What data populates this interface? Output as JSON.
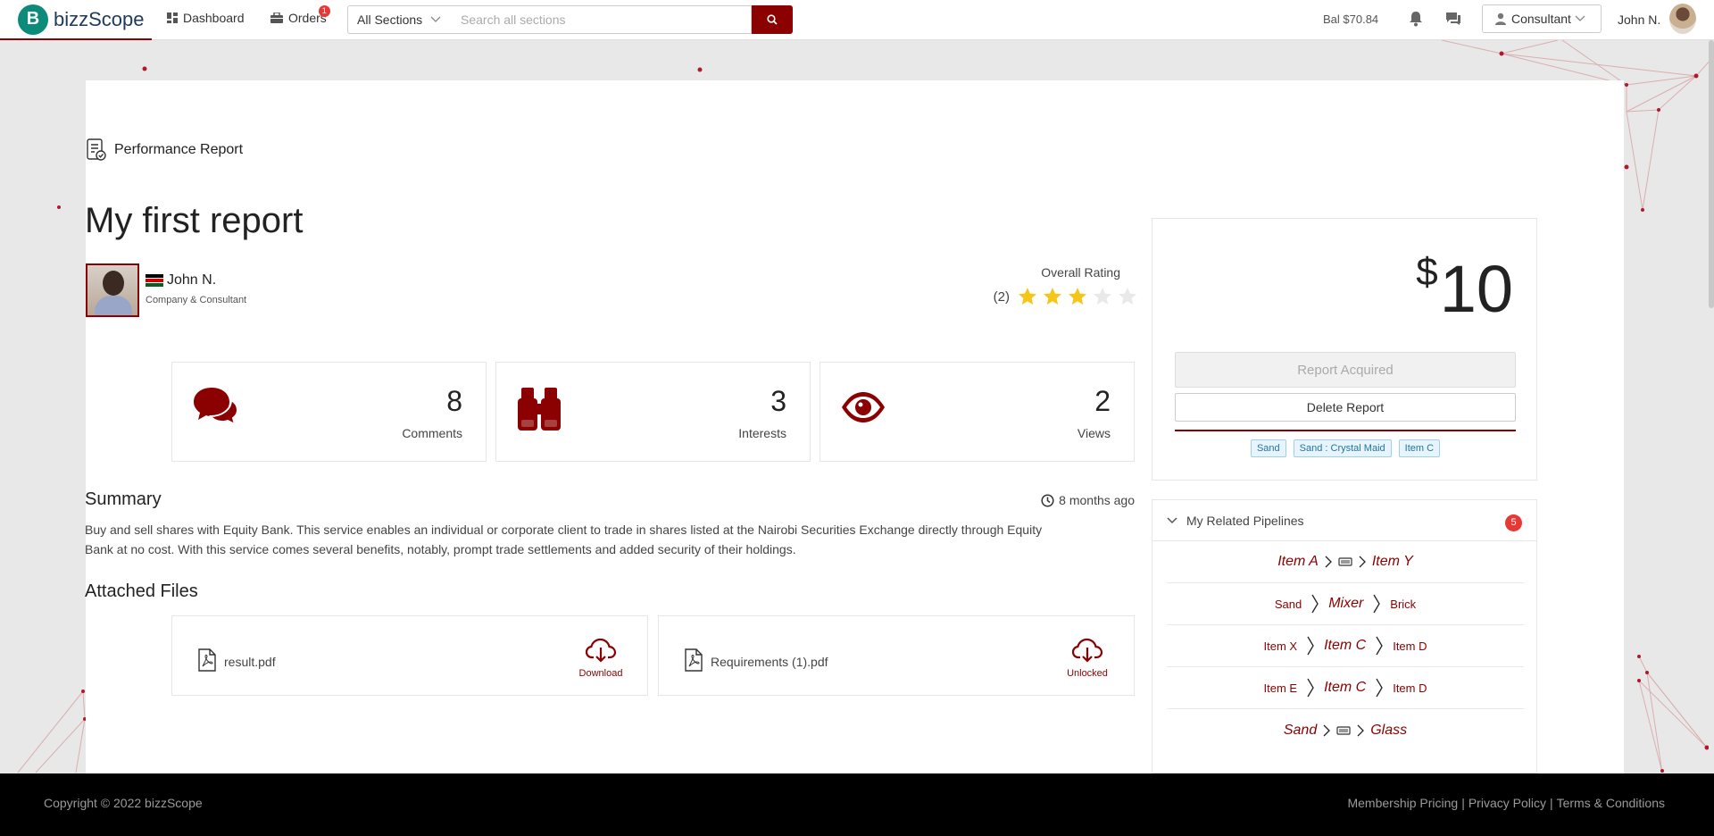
{
  "nav": {
    "brand": "bizzScope",
    "dashboard": "Dashboard",
    "orders": "Orders",
    "orders_badge": "1",
    "section_select": "All Sections",
    "search_placeholder": "Search all sections",
    "balance": "Bal $70.84",
    "role": "Consultant",
    "user_name": "John N."
  },
  "report": {
    "type": "Performance Report",
    "title": "My first report",
    "author_name": "John N.",
    "author_role": "Company & Consultant",
    "rating_label": "Overall Rating",
    "rating_count": "(2)",
    "rating_stars": 3,
    "rating_max": 5
  },
  "stats": {
    "comments": {
      "value": "8",
      "label": "Comments"
    },
    "interests": {
      "value": "3",
      "label": "Interests"
    },
    "views": {
      "value": "2",
      "label": "Views"
    }
  },
  "summary": {
    "title": "Summary",
    "time_ago": "8 months ago",
    "text": "Buy and sell shares with Equity Bank. This service enables an individual or corporate client to trade in shares listed at the Nairobi Securities Exchange directly through Equity Bank at no cost. With this service comes several benefits, notably, prompt trade settlements and added security of their holdings."
  },
  "files": {
    "title": "Attached Files",
    "items": [
      {
        "name": "result.pdf",
        "action": "Download"
      },
      {
        "name": "Requirements (1).pdf",
        "action": "Unlocked"
      }
    ]
  },
  "pricing": {
    "currency": "$",
    "amount": "10",
    "acquired_label": "Report Acquired",
    "delete_label": "Delete Report",
    "tags": [
      "Sand",
      "Sand : Crystal Maid",
      "Item C"
    ]
  },
  "pipelines": {
    "title": "My Related Pipelines",
    "count": "5",
    "rows": [
      {
        "a": "Item A",
        "b": "",
        "c": "Item Y"
      },
      {
        "a": "Sand",
        "b": "Mixer",
        "c": "Brick"
      },
      {
        "a": "Item X",
        "b": "Item C",
        "c": "Item D"
      },
      {
        "a": "Item E",
        "b": "Item C",
        "c": "Item D"
      },
      {
        "a": "Sand",
        "b": "",
        "c": "Glass"
      }
    ]
  },
  "footer": {
    "copyright": "Copyright © 2022 bizzScope",
    "membership": "Membership Pricing",
    "privacy": "Privacy Policy",
    "terms": "Terms & Conditions"
  },
  "colors": {
    "brand_red": "#8b0000",
    "brand_teal": "#0c8b7a",
    "star_gold": "#f5c518",
    "badge_red": "#e53935"
  }
}
